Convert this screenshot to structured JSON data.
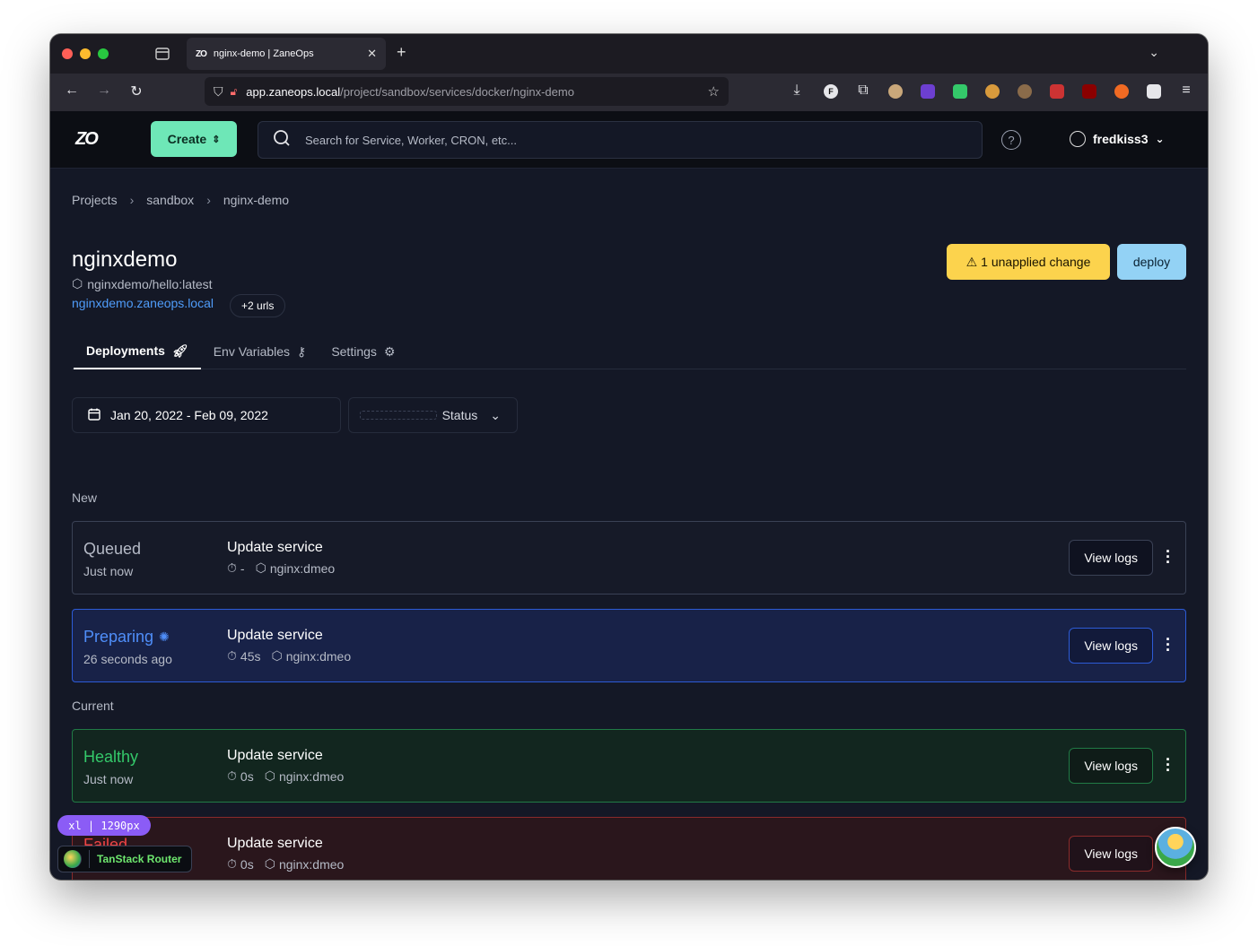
{
  "browser": {
    "tab_title": "nginx-demo | ZaneOps",
    "tab_favicon": "ZO",
    "url_host": "app.zaneops.local",
    "url_path": "/project/sandbox/services/docker/nginx-demo"
  },
  "header": {
    "logo": "ZO",
    "create_label": "Create",
    "search_placeholder": "Search for Service, Worker, CRON, etc...",
    "username": "fredkiss3"
  },
  "breadcrumb": [
    "Projects",
    "sandbox",
    "nginx-demo"
  ],
  "service": {
    "title": "nginxdemo",
    "image": "nginxdemo/hello:latest",
    "url": "nginxdemo.zaneops.local",
    "more_urls": "+2 urls",
    "unapplied_label": "1 unapplied change",
    "deploy_label": "deploy"
  },
  "tabs": [
    {
      "label": "Deployments",
      "icon": "rocket-icon"
    },
    {
      "label": "Env Variables",
      "icon": "key-icon"
    },
    {
      "label": "Settings",
      "icon": "gear-icon"
    }
  ],
  "filters": {
    "date_range": "Jan 20, 2022 - Feb 09, 2022",
    "status_label": "Status"
  },
  "groups": {
    "new": "New",
    "current": "Current"
  },
  "deployments": [
    {
      "status": "Queued",
      "when": "Just now",
      "message": "Update service",
      "duration": "-",
      "image": "nginx:dmeo",
      "view_logs": "View logs"
    },
    {
      "status": "Preparing",
      "when": "26 seconds ago",
      "message": "Update service",
      "duration": "45s",
      "image": "nginx:dmeo",
      "view_logs": "View logs"
    },
    {
      "status": "Healthy",
      "when": "Just now",
      "message": "Update service",
      "duration": "0s",
      "image": "nginx:dmeo",
      "view_logs": "View logs"
    },
    {
      "status": "Failed",
      "when": "",
      "message": "Update service",
      "duration": "0s",
      "image": "nginx:dmeo",
      "view_logs": "View logs"
    }
  ],
  "dev": {
    "breakpoint": "xl | 1290px",
    "router_devtools": "TanStack Router"
  },
  "colors": {
    "accent_create": "#6ee7b7",
    "unapplied": "#fcd34d",
    "deploy": "#93d2f5",
    "preparing": "#4f8ef9",
    "healthy": "#34c96a",
    "failed": "#ef4444"
  }
}
